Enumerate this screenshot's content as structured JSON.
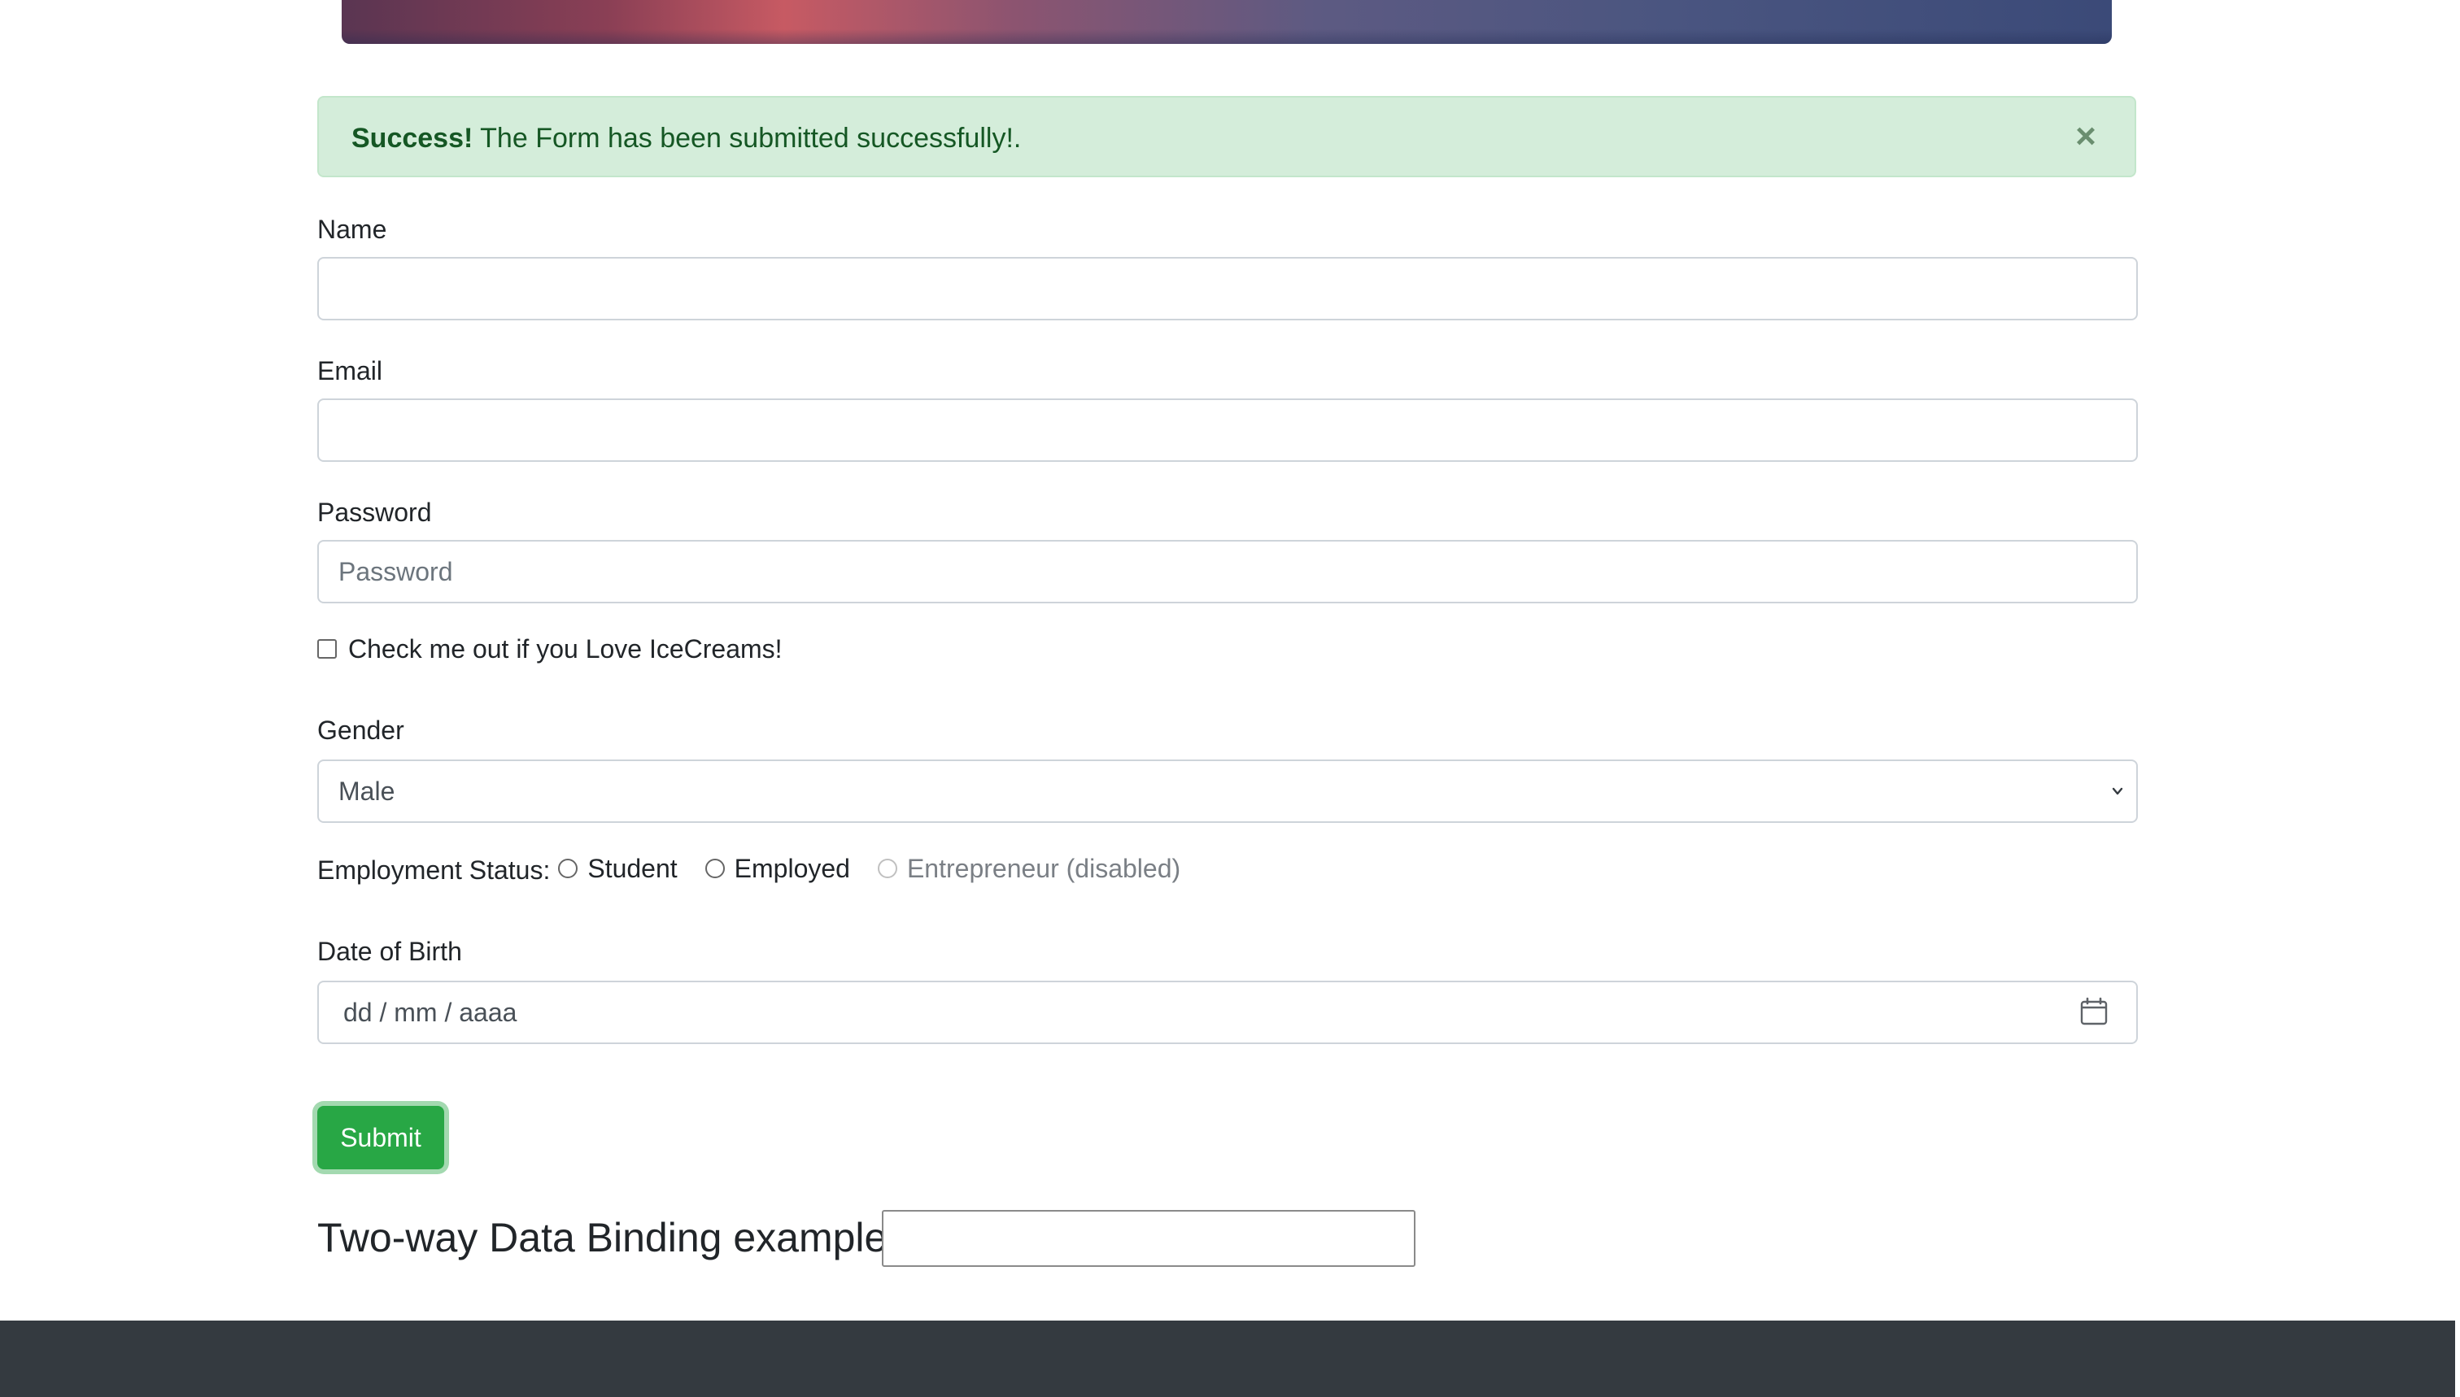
{
  "alert": {
    "strong": "Success!",
    "message": " The Form has been submitted successfully!.",
    "close_symbol": "×"
  },
  "form": {
    "name_label": "Name",
    "name_value": "",
    "email_label": "Email",
    "email_value": "",
    "password_label": "Password",
    "password_placeholder": "Password",
    "checkbox_label": "Check me out if you Love IceCreams!",
    "checkbox_checked": false,
    "gender_label": "Gender",
    "gender_selected": "Male",
    "employment_label": "Employment Status:",
    "employment_options": [
      {
        "label": "Student",
        "disabled": false
      },
      {
        "label": "Employed",
        "disabled": false
      },
      {
        "label": "Entrepreneur (disabled)",
        "disabled": true
      }
    ],
    "dob_label": "Date of Birth",
    "dob_placeholder": "dd / mm / aaaa",
    "submit_label": "Submit"
  },
  "binding": {
    "heading": "Two-way Data Binding example:",
    "value": ""
  },
  "colors": {
    "success_bg": "#d4edda",
    "success_text": "#155724",
    "submit_green": "#28a745",
    "footer_dark": "#343a40"
  },
  "icons": {
    "close": "close-icon",
    "select_arrow": "chevron-down-icon",
    "date_picker": "calendar-icon"
  }
}
